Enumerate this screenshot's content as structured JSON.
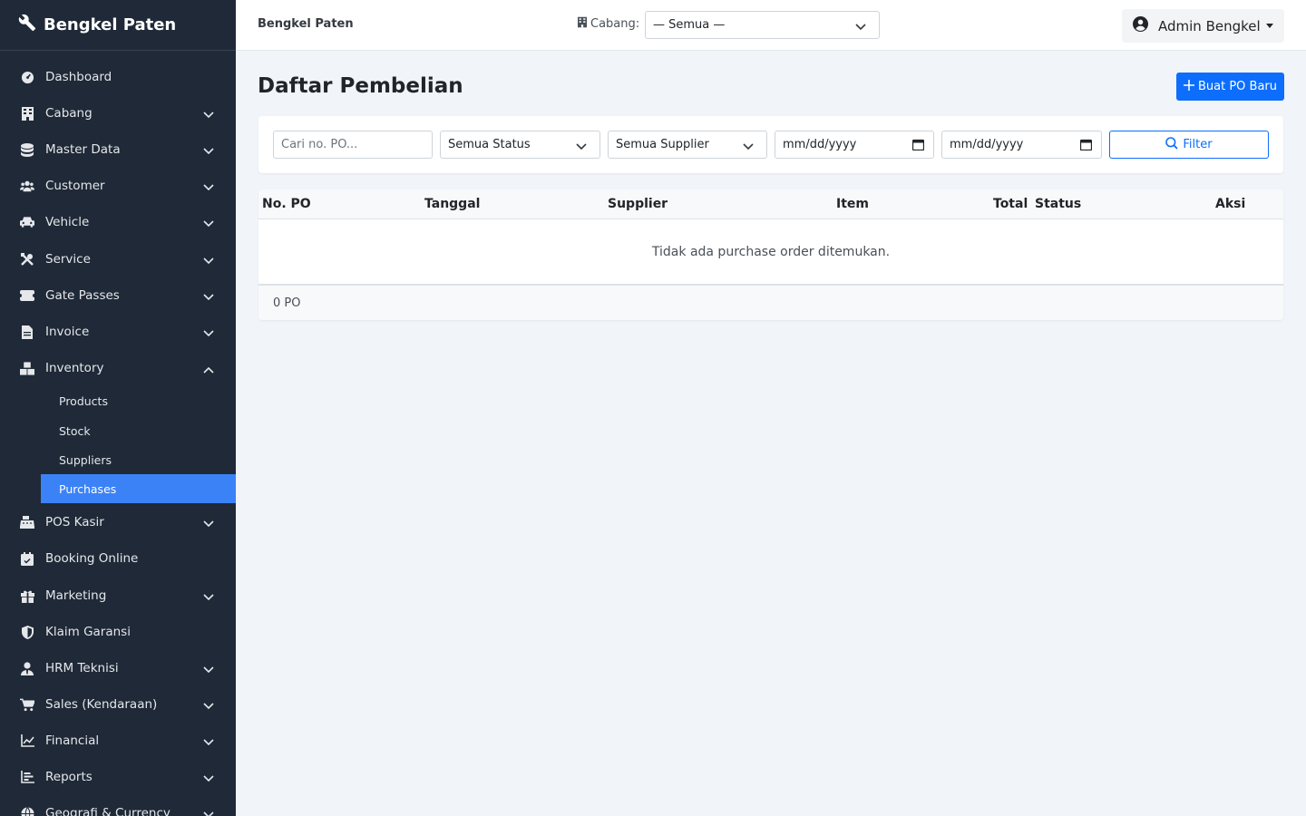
{
  "sidebar": {
    "brand": "Bengkel Paten",
    "items": [
      {
        "label": "Dashboard",
        "icon": "gauge-icon",
        "expandable": false
      },
      {
        "label": "Cabang",
        "icon": "building-icon",
        "expandable": true
      },
      {
        "label": "Master Data",
        "icon": "database-icon",
        "expandable": true
      },
      {
        "label": "Customer",
        "icon": "users-icon",
        "expandable": true
      },
      {
        "label": "Vehicle",
        "icon": "car-icon",
        "expandable": true
      },
      {
        "label": "Service",
        "icon": "tools-icon",
        "expandable": true
      },
      {
        "label": "Gate Passes",
        "icon": "ticket-icon",
        "expandable": true
      },
      {
        "label": "Invoice",
        "icon": "file-invoice-icon",
        "expandable": true
      },
      {
        "label": "Inventory",
        "icon": "boxes-icon",
        "expandable": true,
        "expanded": true
      }
    ],
    "inventory_sub": [
      {
        "label": "Products"
      },
      {
        "label": "Stock"
      },
      {
        "label": "Suppliers"
      },
      {
        "label": "Purchases",
        "active": true
      }
    ],
    "items_after": [
      {
        "label": "POS Kasir",
        "icon": "cash-register-icon",
        "expandable": true
      },
      {
        "label": "Booking Online",
        "icon": "calendar-check-icon",
        "expandable": false
      },
      {
        "label": "Marketing",
        "icon": "gift-icon",
        "expandable": true
      },
      {
        "label": "Klaim Garansi",
        "icon": "shield-icon",
        "expandable": false
      },
      {
        "label": "HRM Teknisi",
        "icon": "user-tie-icon",
        "expandable": true
      },
      {
        "label": "Sales (Kendaraan)",
        "icon": "cart-icon",
        "expandable": true
      },
      {
        "label": "Financial",
        "icon": "chart-line-icon",
        "expandable": true
      },
      {
        "label": "Reports",
        "icon": "chart-bar-icon",
        "expandable": true
      },
      {
        "label": "Geografi & Currency",
        "icon": "globe-icon",
        "expandable": true
      }
    ]
  },
  "topbar": {
    "brand": "Bengkel Paten",
    "branch_label": "Cabang:",
    "branch_value": "— Semua —",
    "user_name": "Admin Bengkel"
  },
  "main": {
    "title": "Daftar Pembelian",
    "new_po_label": "Buat PO Baru",
    "filters": {
      "search_placeholder": "Cari no. PO...",
      "status_value": "Semua Status",
      "supplier_value": "Semua Supplier",
      "date_from_placeholder": "mm/dd/yyyy",
      "date_to_placeholder": "mm/dd/yyyy",
      "filter_label": "Filter"
    },
    "table": {
      "headers": [
        "No. PO",
        "Tanggal",
        "Supplier",
        "Item",
        "Total",
        "Status",
        "Aksi"
      ],
      "empty_message": "Tidak ada purchase order ditemukan.",
      "footer_count": "0 PO"
    }
  },
  "colors": {
    "sidebar_bg": "#1f2937",
    "active_item": "#3b82f6",
    "primary": "#0d6efd",
    "page_bg": "#f1f4f9"
  }
}
